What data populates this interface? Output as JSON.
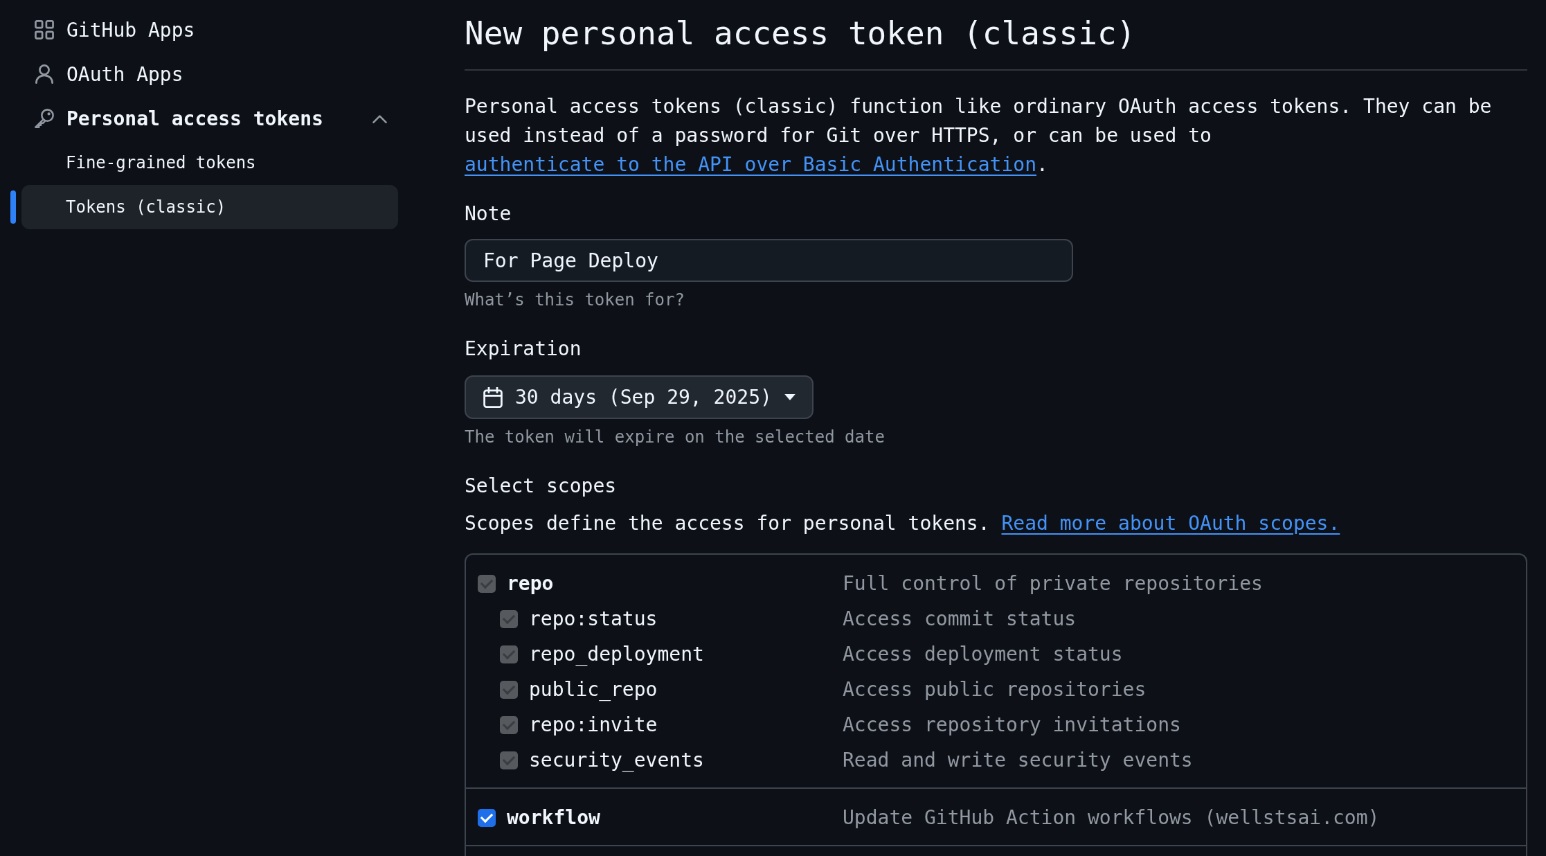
{
  "sidebar": {
    "items": [
      {
        "label": "GitHub Apps",
        "selected": false
      },
      {
        "label": "OAuth Apps",
        "selected": false
      },
      {
        "label": "Personal access tokens",
        "selected": false,
        "expanded": true,
        "children": [
          {
            "label": "Fine-grained tokens",
            "selected": false
          },
          {
            "label": "Tokens (classic)",
            "selected": true
          }
        ]
      }
    ]
  },
  "page_title": "New personal access token (classic)",
  "intro": {
    "text": "Personal access tokens (classic) function like ordinary OAuth access tokens. They can be used instead of a password for Git over HTTPS, or can be used to",
    "link": "authenticate to the API over Basic Authentication",
    "after": "."
  },
  "note": {
    "label": "Note",
    "value": "For Page Deploy",
    "hint": "What’s this token for?"
  },
  "expiration": {
    "label": "Expiration",
    "value": "30 days (Sep 29, 2025)",
    "hint": "The token will expire on the selected date"
  },
  "scopes": {
    "label": "Select scopes",
    "text": "Scopes define the access for personal tokens.",
    "link": "Read more about OAuth scopes.",
    "items": [
      {
        "name": "repo",
        "description": "Full control of private repositories",
        "checked": true,
        "disabled": true,
        "children": [
          {
            "name": "repo:status",
            "description": "Access commit status",
            "checked": true,
            "disabled": true
          },
          {
            "name": "repo_deployment",
            "description": "Access deployment status",
            "checked": true,
            "disabled": true
          },
          {
            "name": "public_repo",
            "description": "Access public repositories",
            "checked": true,
            "disabled": true
          },
          {
            "name": "repo:invite",
            "description": "Access repository invitations",
            "checked": true,
            "disabled": true
          },
          {
            "name": "security_events",
            "description": "Read and write security events",
            "checked": true,
            "disabled": true
          }
        ]
      },
      {
        "name": "workflow",
        "description": "Update GitHub Action workflows (wellstsai.com)",
        "checked": true,
        "disabled": false
      }
    ]
  }
}
